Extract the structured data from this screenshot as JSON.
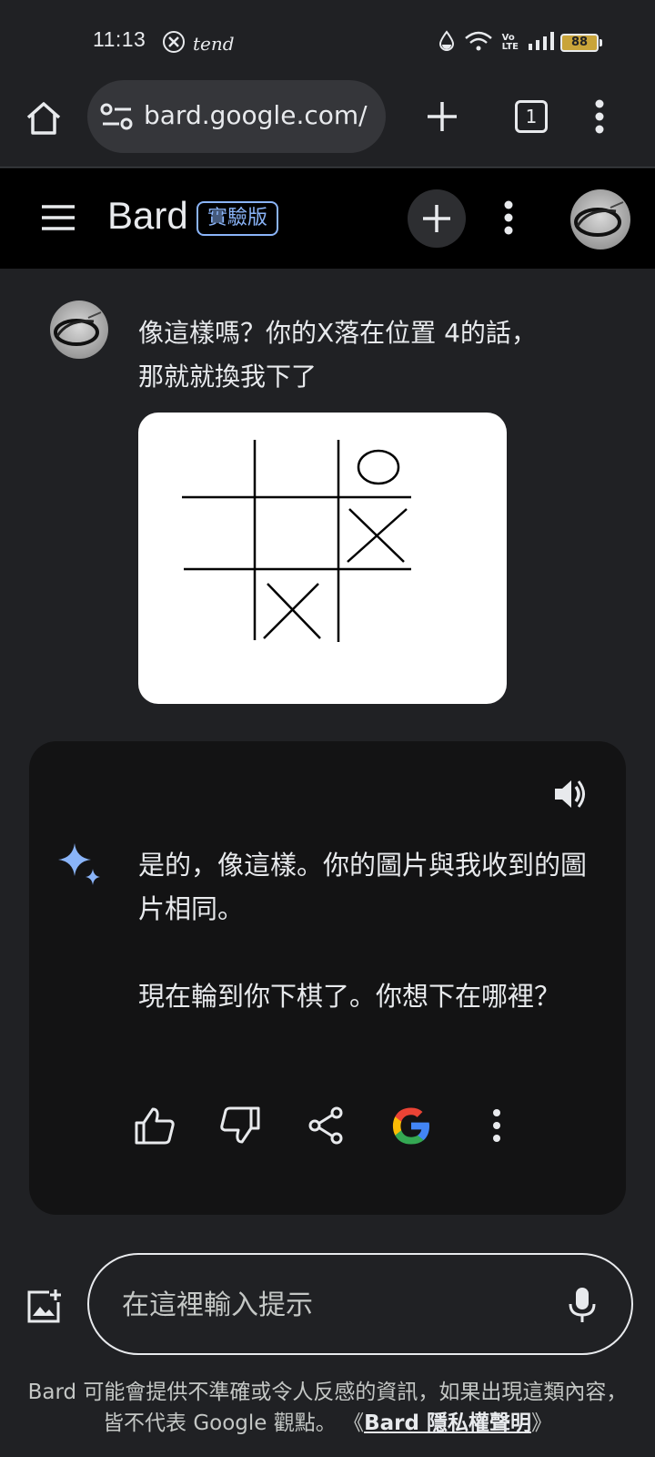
{
  "status_bar": {
    "time": "11:13",
    "x_icon": "x-icon",
    "tend_label": "tend",
    "battery": "88",
    "icons": [
      "water-drop-icon",
      "wifi-icon",
      "volte-icon",
      "signal-icon",
      "battery-icon"
    ]
  },
  "browser": {
    "url": "bard.google.com/",
    "tab_count": "1",
    "icons": [
      "home-icon",
      "site-settings-icon",
      "plus-icon",
      "tabs-icon",
      "more-vert-icon"
    ]
  },
  "header": {
    "title": "Bard",
    "badge": "實驗版",
    "icons": [
      "menu-icon",
      "plus-icon",
      "more-vert-icon",
      "avatar"
    ]
  },
  "conversation": {
    "user_message": "像這樣嗎？你的X落在位置 4的話，那就就換我下了",
    "board": {
      "cells": [
        "",
        "",
        "O",
        "",
        "",
        "X",
        "",
        "X",
        ""
      ]
    },
    "response": {
      "paragraphs": [
        "是的，像這樣。你的圖片與我收到的圖片相同。",
        "現在輪到你下棋了。你想下在哪裡？"
      ],
      "action_icons": [
        "thumb-up-icon",
        "thumb-down-icon",
        "share-icon",
        "google-icon",
        "more-vert-icon"
      ]
    }
  },
  "input": {
    "placeholder": "在這裡輸入提示"
  },
  "disclaimer": {
    "text": "Bard 可能會提供不準確或令人反感的資訊，如果出現這類內容，皆不代表 Google 觀點。",
    "link_open": "《",
    "link": "Bard 隱私權聲明",
    "link_close": "》"
  },
  "colors": {
    "background": "#202124",
    "header": "#000000",
    "card": "#131314",
    "accent": "#8ab4f8"
  }
}
